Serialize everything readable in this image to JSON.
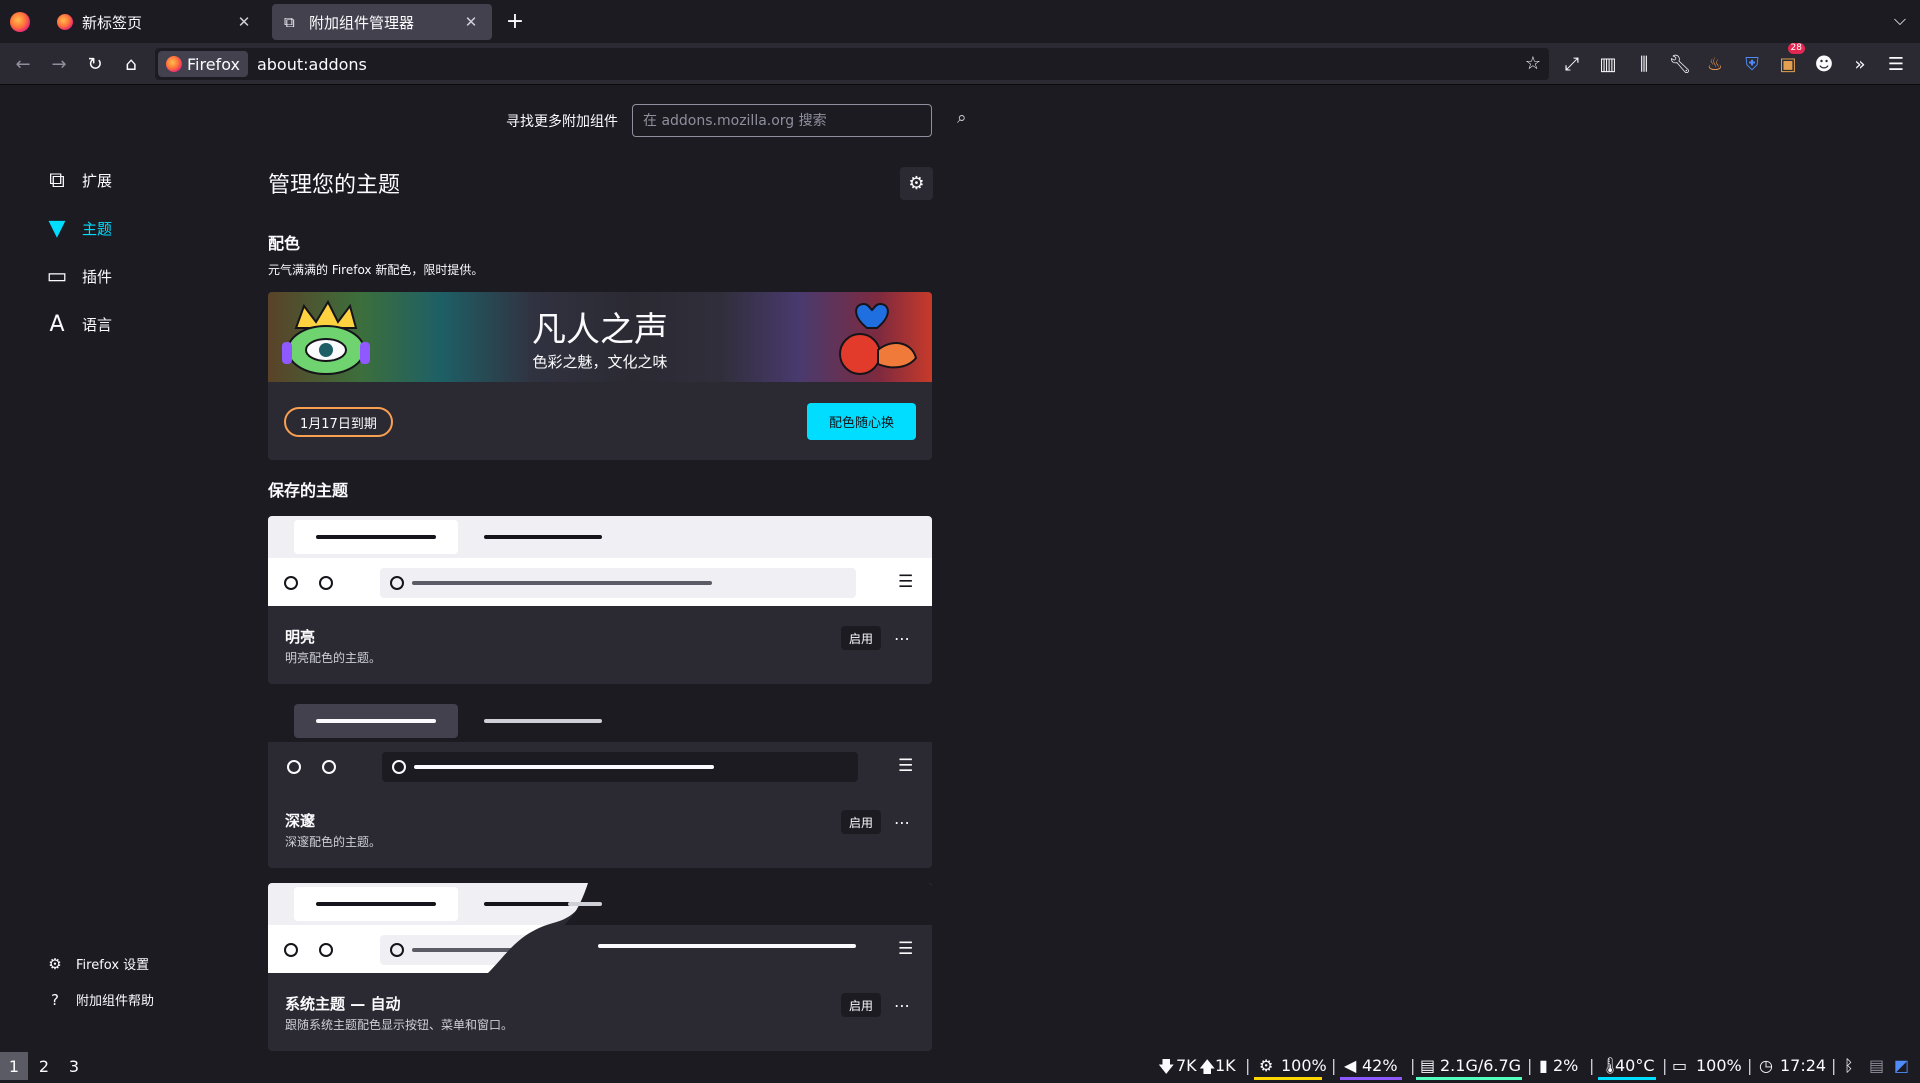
{
  "tabs": [
    {
      "title": "新标签页",
      "active": false
    },
    {
      "title": "附加组件管理器",
      "active": true
    }
  ],
  "navbar": {
    "identity_label": "Firefox",
    "url": "about:addons",
    "extension_badge": "28"
  },
  "search": {
    "label": "寻找更多附加组件",
    "placeholder": "在 addons.mozilla.org 搜索"
  },
  "sidebar": {
    "items": [
      {
        "label": "扩展",
        "icon": "puzzle-icon"
      },
      {
        "label": "主题",
        "icon": "brush-icon",
        "selected": true
      },
      {
        "label": "插件",
        "icon": "plugin-icon"
      },
      {
        "label": "语言",
        "icon": "language-icon"
      }
    ],
    "footer": [
      {
        "label": "Firefox 设置",
        "icon": "gear-icon"
      },
      {
        "label": "附加组件帮助",
        "icon": "help-icon"
      }
    ]
  },
  "main": {
    "title": "管理您的主题",
    "colorways": {
      "heading": "配色",
      "description": "元气满满的 Firefox 新配色，限时提供。",
      "banner_title": "凡人之声",
      "banner_subtitle": "色彩之魅，文化之味",
      "expiry": "1月17日到期",
      "button": "配色随心换"
    },
    "saved_heading": "保存的主题",
    "themes": [
      {
        "name": "明亮",
        "description": "明亮配色的主题。",
        "enable_label": "启用"
      },
      {
        "name": "深邃",
        "description": "深邃配色的主题。",
        "enable_label": "启用"
      },
      {
        "name": "系统主题 — 自动",
        "description": "跟随系统主题配色显示按钮、菜单和窗口。",
        "enable_label": "启用"
      }
    ]
  },
  "statusbar": {
    "workspaces": [
      "1",
      "2",
      "3"
    ],
    "net_down": "7K",
    "net_up": "1K",
    "cpu": "100%",
    "volume": "42%",
    "memory": "2.1G/6.7G",
    "disk": "2%",
    "temp": "40°C",
    "battery": "100%",
    "time": "17:24"
  },
  "colors": {
    "accent": "#00ddff",
    "background": "#1c1b22",
    "surface": "#2b2a33",
    "expiry_border": "#f9a050"
  }
}
